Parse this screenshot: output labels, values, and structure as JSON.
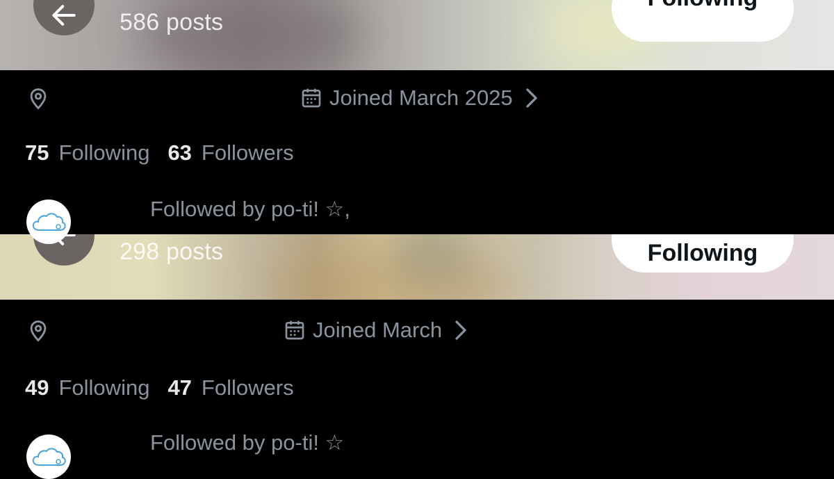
{
  "profiles": [
    {
      "posts_label": "586 posts",
      "follow_button_label": "Following",
      "joined_label": "Joined March 2025",
      "following_count": "75",
      "following_label": "Following",
      "followers_count": "63",
      "followers_label": "Followers",
      "followed_by_text": "Followed by po-ti! ☆,"
    },
    {
      "posts_label": "298 posts",
      "follow_button_label": "Following",
      "joined_label": "Joined March",
      "following_count": "49",
      "following_label": "Following",
      "followers_count": "47",
      "followers_label": "Followers",
      "followed_by_text": "Followed by po-ti! ☆"
    }
  ],
  "icons": {
    "back": "arrow-left-icon",
    "location": "location-pin-icon",
    "calendar": "calendar-icon",
    "chevron": "chevron-right-icon",
    "avatar": "cloud-avatar-icon"
  },
  "colors": {
    "background": "#000000",
    "secondary_text": "#8b949e",
    "primary_text": "#e7e9ea",
    "button_bg": "#ffffff",
    "button_text": "#0f1419"
  }
}
